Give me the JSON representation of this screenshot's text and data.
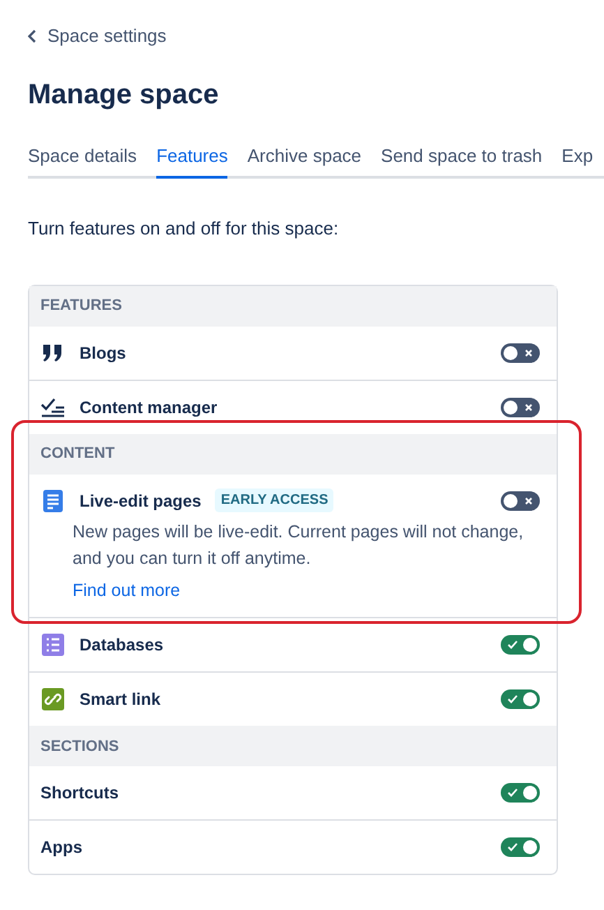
{
  "back_link": "Space settings",
  "title": "Manage space",
  "tabs": [
    {
      "label": "Space details",
      "selected": false
    },
    {
      "label": "Features",
      "selected": true
    },
    {
      "label": "Archive space",
      "selected": false
    },
    {
      "label": "Send space to trash",
      "selected": false
    },
    {
      "label": "Exp",
      "selected": false
    }
  ],
  "intro": "Turn features on and off for this space:",
  "sections": [
    {
      "heading": "FEATURES",
      "highlighted": false,
      "items": [
        {
          "kind": "quote",
          "label": "Blogs",
          "on": false
        },
        {
          "kind": "checklist",
          "label": "Content manager",
          "on": false
        }
      ]
    },
    {
      "heading": "CONTENT",
      "highlighted": true,
      "items": [
        {
          "kind": "page",
          "label": "Live-edit pages",
          "badge": "EARLY ACCESS",
          "on": false,
          "description": "New pages will be live-edit. Current pages will not change, and you can turn it off anytime.",
          "link": "Find out more"
        }
      ]
    },
    {
      "highlighted": false,
      "items": [
        {
          "kind": "database",
          "label": "Databases",
          "on": true
        },
        {
          "kind": "smartlink",
          "label": "Smart link",
          "on": true
        }
      ]
    },
    {
      "heading": "SECTIONS",
      "highlighted": false,
      "items": [
        {
          "kind": "plain",
          "label": "Shortcuts",
          "on": true
        },
        {
          "kind": "plain",
          "label": "Apps",
          "on": true
        }
      ]
    }
  ]
}
